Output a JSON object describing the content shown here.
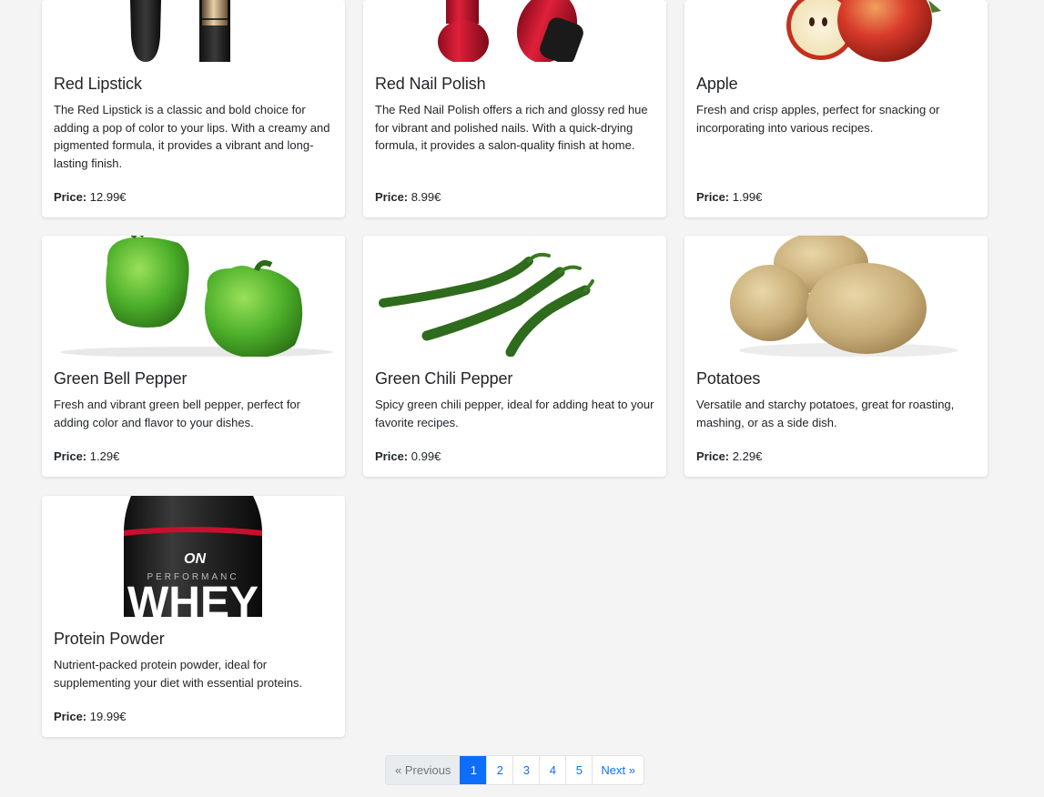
{
  "products": [
    {
      "title": "Red Lipstick",
      "description": "The Red Lipstick is a classic and bold choice for adding a pop of color to your lips. With a creamy and pigmented formula, it provides a vibrant and long-lasting finish.",
      "price_label": "Price:",
      "price": "12.99€",
      "image": "lipstick-image"
    },
    {
      "title": "Red Nail Polish",
      "description": "The Red Nail Polish offers a rich and glossy red hue for vibrant and polished nails. With a quick-drying formula, it provides a salon-quality finish at home.",
      "price_label": "Price:",
      "price": "8.99€",
      "image": "nail-polish-image"
    },
    {
      "title": "Apple",
      "description": "Fresh and crisp apples, perfect for snacking or incorporating into various recipes.",
      "price_label": "Price:",
      "price": "1.99€",
      "image": "apple-image"
    },
    {
      "title": "Green Bell Pepper",
      "description": "Fresh and vibrant green bell pepper, perfect for adding color and flavor to your dishes.",
      "price_label": "Price:",
      "price": "1.29€",
      "image": "bell-pepper-image"
    },
    {
      "title": "Green Chili Pepper",
      "description": "Spicy green chili pepper, ideal for adding heat to your favorite recipes.",
      "price_label": "Price:",
      "price": "0.99€",
      "image": "chili-pepper-image"
    },
    {
      "title": "Potatoes",
      "description": "Versatile and starchy potatoes, great for roasting, mashing, or as a side dish.",
      "price_label": "Price:",
      "price": "2.29€",
      "image": "potatoes-image"
    },
    {
      "title": "Protein Powder",
      "description": "Nutrient-packed protein powder, ideal for supplementing your diet with essential proteins.",
      "price_label": "Price:",
      "price": "19.99€",
      "image": "protein-powder-image",
      "label_text": "PERFORMANC",
      "label_big": "WHEY",
      "label_logo": "ON"
    }
  ],
  "pagination": {
    "previous": "« Previous",
    "pages": [
      "1",
      "2",
      "3",
      "4",
      "5"
    ],
    "active": "1",
    "next": "Next »"
  },
  "colors": {
    "accent": "#0d6efd",
    "background": "#f4f4f4"
  }
}
